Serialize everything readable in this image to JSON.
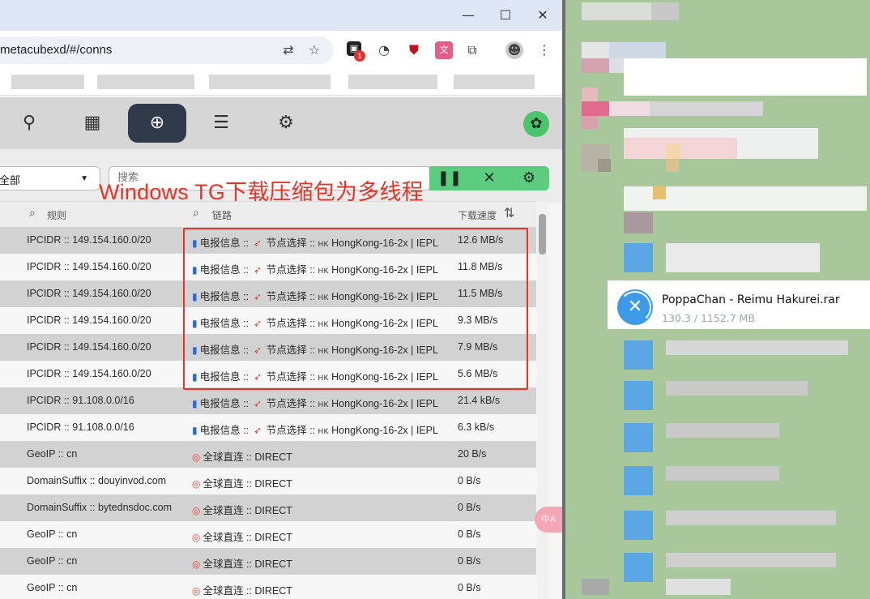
{
  "browser": {
    "window_controls": {
      "minimize": "—",
      "maximize": "☐",
      "close": "✕"
    },
    "url": "metacubexd/#/conns",
    "extension_badge": "1"
  },
  "app": {
    "nav": {
      "items": [
        {
          "name": "overview",
          "icon": "globe-pin-icon"
        },
        {
          "name": "proxies",
          "icon": "map-icon"
        },
        {
          "name": "connections",
          "icon": "network-icon",
          "active": true
        },
        {
          "name": "logs",
          "icon": "document-icon"
        },
        {
          "name": "config",
          "icon": "gear-icon"
        }
      ],
      "theme_icon": "palette-icon"
    },
    "filter": {
      "select_value": "全部",
      "search_placeholder": "搜索"
    },
    "actions": {
      "pause": "pause-icon",
      "close": "close-icon",
      "settings": "gear-icon"
    },
    "annotation": "Windows TG下载压缩包为多线程",
    "table": {
      "headers": {
        "rule": "规则",
        "chain": "链路",
        "download_speed": "下载速度"
      },
      "rows": [
        {
          "rule": "IPCIDR :: 149.154.160.0/20",
          "chain_icon": "phone",
          "chain_a": "电报信息 ::",
          "chain_b": "节点选择 ::",
          "flag": "HK",
          "chain_c": "HongKong-16-2x | IEPL",
          "speed": "12.6 MB/s"
        },
        {
          "rule": "IPCIDR :: 149.154.160.0/20",
          "chain_icon": "phone",
          "chain_a": "电报信息 ::",
          "chain_b": "节点选择 ::",
          "flag": "HK",
          "chain_c": "HongKong-16-2x | IEPL",
          "speed": "11.8 MB/s"
        },
        {
          "rule": "IPCIDR :: 149.154.160.0/20",
          "chain_icon": "phone",
          "chain_a": "电报信息 ::",
          "chain_b": "节点选择 ::",
          "flag": "HK",
          "chain_c": "HongKong-16-2x | IEPL",
          "speed": "11.5 MB/s"
        },
        {
          "rule": "IPCIDR :: 149.154.160.0/20",
          "chain_icon": "phone",
          "chain_a": "电报信息 ::",
          "chain_b": "节点选择 ::",
          "flag": "HK",
          "chain_c": "HongKong-16-2x | IEPL",
          "speed": "9.3 MB/s"
        },
        {
          "rule": "IPCIDR :: 149.154.160.0/20",
          "chain_icon": "phone",
          "chain_a": "电报信息 ::",
          "chain_b": "节点选择 ::",
          "flag": "HK",
          "chain_c": "HongKong-16-2x | IEPL",
          "speed": "7.9 MB/s"
        },
        {
          "rule": "IPCIDR :: 149.154.160.0/20",
          "chain_icon": "phone",
          "chain_a": "电报信息 ::",
          "chain_b": "节点选择 ::",
          "flag": "HK",
          "chain_c": "HongKong-16-2x | IEPL",
          "speed": "5.6 MB/s"
        },
        {
          "rule": "IPCIDR :: 91.108.0.0/16",
          "chain_icon": "phone",
          "chain_a": "电报信息 ::",
          "chain_b": "节点选择 ::",
          "flag": "HK",
          "chain_c": "HongKong-16-2x | IEPL",
          "speed": "21.4 kB/s"
        },
        {
          "rule": "IPCIDR :: 91.108.0.0/16",
          "chain_icon": "phone",
          "chain_a": "电报信息 ::",
          "chain_b": "节点选择 ::",
          "flag": "HK",
          "chain_c": "HongKong-16-2x | IEPL",
          "speed": "6.3 kB/s"
        },
        {
          "rule": "GeoIP :: cn",
          "chain_icon": "target",
          "chain_a": "全球直连 :: DIRECT",
          "chain_b": "",
          "flag": "",
          "chain_c": "",
          "speed": "20 B/s"
        },
        {
          "rule": "DomainSuffix :: douyinvod.com",
          "chain_icon": "target",
          "chain_a": "全球直连 :: DIRECT",
          "chain_b": "",
          "flag": "",
          "chain_c": "",
          "speed": "0 B/s"
        },
        {
          "rule": "DomainSuffix :: bytednsdoc.com",
          "chain_icon": "target",
          "chain_a": "全球直连 :: DIRECT",
          "chain_b": "",
          "flag": "",
          "chain_c": "",
          "speed": "0 B/s"
        },
        {
          "rule": "GeoIP :: cn",
          "chain_icon": "target",
          "chain_a": "全球直连 :: DIRECT",
          "chain_b": "",
          "flag": "",
          "chain_c": "",
          "speed": "0 B/s"
        },
        {
          "rule": "GeoIP :: cn",
          "chain_icon": "target",
          "chain_a": "全球直连 :: DIRECT",
          "chain_b": "",
          "flag": "",
          "chain_c": "",
          "speed": "0 B/s"
        },
        {
          "rule": "GeoIP :: cn",
          "chain_icon": "target",
          "chain_a": "全球直连 :: DIRECT",
          "chain_b": "",
          "flag": "",
          "chain_c": "",
          "speed": "0 B/s"
        }
      ]
    },
    "translate_badge": "中A"
  },
  "telegram": {
    "file": {
      "name": "PoppaChan - Reimu Hakurei.rar",
      "progress_text": "130.3 / 1152.7 MB",
      "progress_fraction": 0.113
    }
  },
  "colors": {
    "accent_green": "#5ccc7f",
    "active_nav": "#2f3a4a",
    "annotation_red": "#e53528",
    "telegram_blue": "#3d9ae8"
  }
}
